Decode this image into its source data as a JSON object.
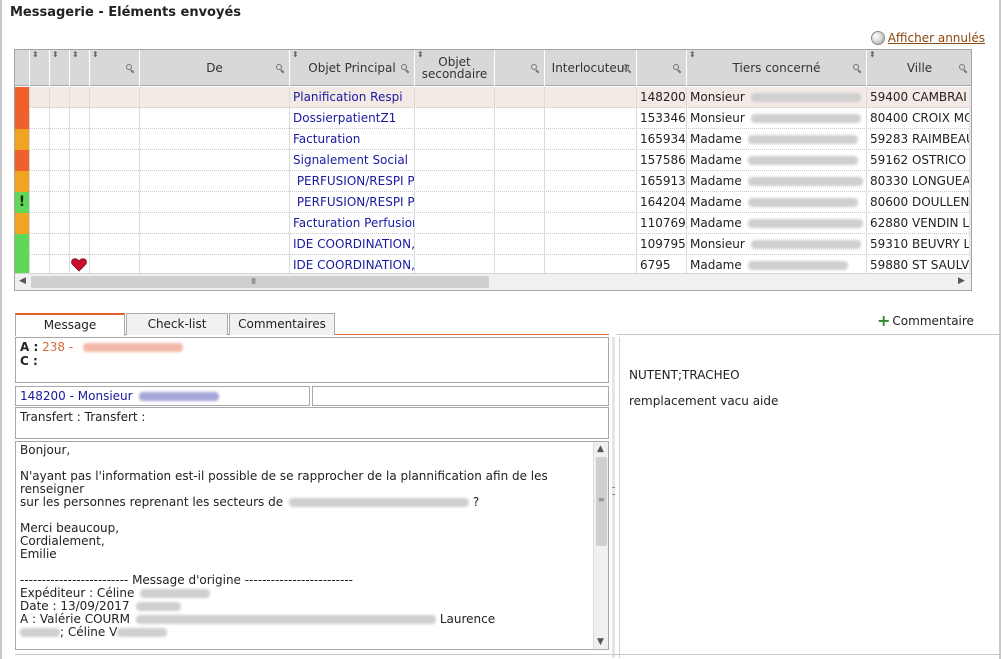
{
  "window": {
    "title": "Messagerie - Eléments envoyés",
    "show_cancelled": "Afficher annulés"
  },
  "grid": {
    "columns": [
      {
        "label": ""
      },
      {
        "label": ""
      },
      {
        "label": ""
      },
      {
        "label": ""
      },
      {
        "label": "De"
      },
      {
        "label": "Objet Principal"
      },
      {
        "label": "Objet secondaire"
      },
      {
        "label": "Interlocuteur"
      },
      {
        "label": ""
      },
      {
        "label": "Tiers concerné"
      },
      {
        "label": "Ville"
      }
    ],
    "rows": [
      {
        "priority": "red",
        "flag": "",
        "objet": "Planification Respi",
        "code": "148200",
        "civilite": "Monsieur",
        "ville": "59400 CAMBRAI"
      },
      {
        "priority": "red",
        "flag": "",
        "objet": "DossierpatientZ1",
        "code": "153346",
        "civilite": "Monsieur",
        "ville": "80400 CROIX MO"
      },
      {
        "priority": "orange",
        "flag": "",
        "objet": "Facturation",
        "code": "165934",
        "civilite": "Madame",
        "ville": "59283 RAIMBEAU"
      },
      {
        "priority": "red",
        "flag": "",
        "objet": "Signalement Social",
        "code": "157586",
        "civilite": "Madame",
        "ville": "59162 OSTRICO"
      },
      {
        "priority": "orange",
        "flag": "",
        "objet": " PERFUSION/RESPI P",
        "code": "165913",
        "civilite": "Madame",
        "ville": "80330 LONGUEA"
      },
      {
        "priority": "green",
        "flag": "exclamation",
        "objet": " PERFUSION/RESPI P",
        "code": "164204",
        "civilite": "Madame",
        "ville": "80600 DOULLENS"
      },
      {
        "priority": "orange",
        "flag": "",
        "objet": "Facturation Perfusion",
        "code": "110769",
        "civilite": "Madame",
        "ville": "62880 VENDIN L"
      },
      {
        "priority": "green",
        "flag": "",
        "objet": "IDE COORDINATION,",
        "code": "109795",
        "civilite": "Monsieur",
        "ville": "59310 BEUVRY L"
      },
      {
        "priority": "green",
        "flag": "heart",
        "objet": "IDE COORDINATION,",
        "code": "6795",
        "civilite": "Madame",
        "ville": "59880 ST SAULV"
      }
    ],
    "scroll_grip": "III"
  },
  "tabs": [
    {
      "label": "Message"
    },
    {
      "label": "Check-list"
    },
    {
      "label": "Commentaires"
    }
  ],
  "comment_button": {
    "label": "Commentaire"
  },
  "message": {
    "to_label": "A :",
    "to_value": "238 - ",
    "cc_label": "C :",
    "tiers": "148200 - Monsieur",
    "transfer": "Transfert : Transfert :",
    "body": {
      "l1": "Bonjour,",
      "l2": "N'ayant pas l'information est-il possible de se rapprocher de la plannification afin de les renseigner",
      "l3": "sur les personnes reprenant les secteurs de",
      "l3_end": "?",
      "l4": "Merci beaucoup,",
      "l5": "Cordialement,",
      "l6": "Emilie",
      "l7": "------------------------- Message d'origine -------------------------",
      "l8": "Expéditeur : Céline",
      "l9": "Date : 13/09/2017",
      "l10a": "A : Valérie COURM",
      "l10b": "Laurence",
      "l11": "; Céline V"
    }
  },
  "side_panel": {
    "line1": "NUTENT;TRACHEO",
    "line2": "remplacement vacu aide"
  },
  "colors": {
    "priority_red": "#f0602a",
    "priority_orange": "#f0a422",
    "priority_green": "#5fd85a",
    "tab_accent": "#e0602a",
    "link_blue": "#1a1aa0"
  }
}
